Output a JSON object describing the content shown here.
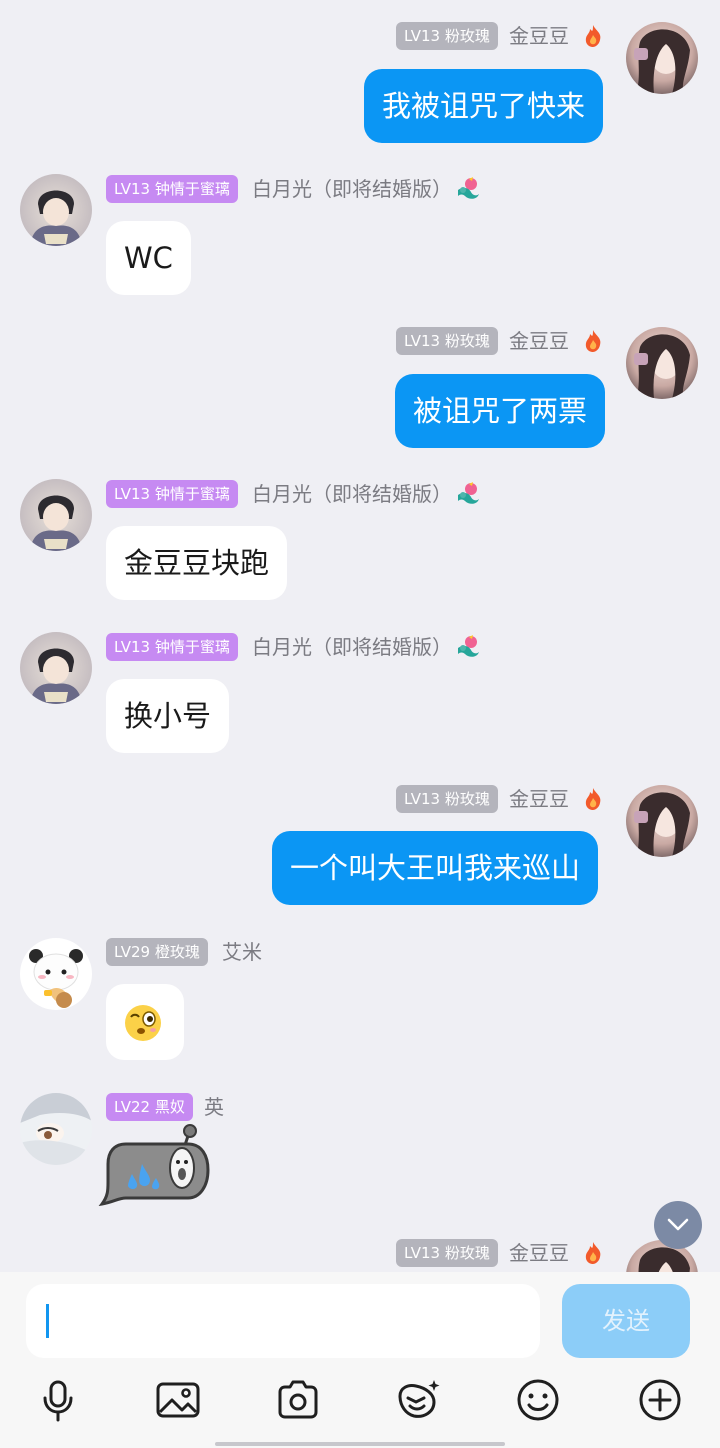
{
  "messages": [
    {
      "side": "right",
      "level": "LV13",
      "title": "粉玫瑰",
      "nickname": "金豆豆",
      "text": "我被诅咒了快来"
    },
    {
      "side": "left",
      "level": "LV13",
      "title": "钟情于蜜璃",
      "nickname": "白月光（即将结婚版）",
      "text": "WC"
    },
    {
      "side": "right",
      "level": "LV13",
      "title": "粉玫瑰",
      "nickname": "金豆豆",
      "text": "被诅咒了两票"
    },
    {
      "side": "left",
      "level": "LV13",
      "title": "钟情于蜜璃",
      "nickname": "白月光（即将结婚版）",
      "text": "金豆豆块跑"
    },
    {
      "side": "left",
      "level": "LV13",
      "title": "钟情于蜜璃",
      "nickname": "白月光（即将结婚版）",
      "text": "换小号"
    },
    {
      "side": "right",
      "level": "LV13",
      "title": "粉玫瑰",
      "nickname": "金豆豆",
      "text": "一个叫大王叫我来巡山"
    },
    {
      "side": "left",
      "level": "LV29",
      "title": "橙玫瑰",
      "nickname": "艾米",
      "content": "emoji-surprised"
    },
    {
      "side": "left",
      "level": "LV22",
      "title": "黑奴",
      "nickname": "英",
      "content": "sticker-sweat"
    },
    {
      "side": "right",
      "level": "LV13",
      "title": "粉玫瑰",
      "nickname": "金豆豆"
    }
  ],
  "labels": {
    "m1": "LV13 粉玫瑰",
    "m2": "LV13 钟情于蜜璃",
    "m3": "LV13 粉玫瑰",
    "m4": "LV13 钟情于蜜璃",
    "m5": "LV13 钟情于蜜璃",
    "m6": "LV13 粉玫瑰",
    "m7": "LV29 橙玫瑰",
    "m8": "LV22 黑奴",
    "m9": "LV13 粉玫瑰"
  },
  "input": {
    "value": "",
    "send_label": "发送"
  },
  "toolbar": [
    "mic-icon",
    "image-icon",
    "camera-icon",
    "sticker-icon",
    "emoji-icon",
    "plus-icon"
  ],
  "colors": {
    "own_bubble": "#0b96f4",
    "other_bubble": "#ffffff",
    "badge_gray": "#b4b4bc",
    "badge_purple": "#c68af2",
    "background": "#efeff4"
  }
}
